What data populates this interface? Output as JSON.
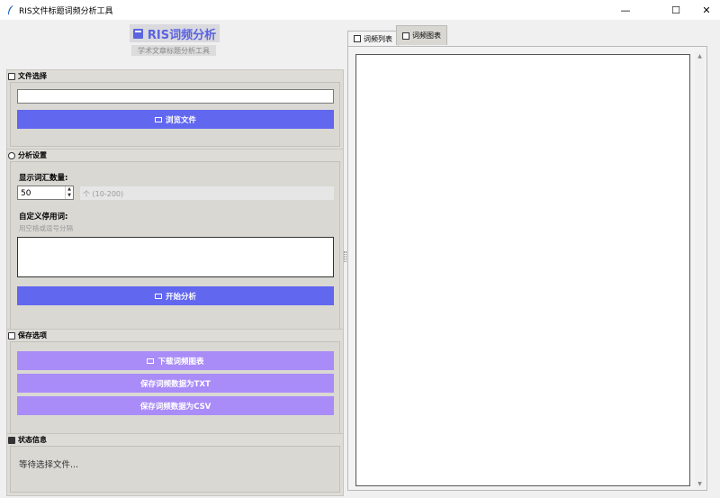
{
  "window": {
    "title": "RIS文件标题词频分析工具",
    "minimize": "—",
    "maximize": "☐",
    "close": "✕"
  },
  "header": {
    "title": "RIS词频分析",
    "subtitle": "学术文章标题分析工具",
    "accent_color": "#5b63e0"
  },
  "file_section": {
    "legend": "文件选择",
    "path_value": "",
    "browse_button": "浏览文件"
  },
  "settings_section": {
    "legend": "分析设置",
    "word_count_label": "显示词汇数量:",
    "word_count_value": "50",
    "word_count_unit": "个 (10-200)",
    "stopwords_label": "自定义停用词:",
    "stopwords_hint": "用空格或逗号分隔",
    "stopwords_value": "",
    "start_button": "开始分析"
  },
  "save_section": {
    "legend": "保存选项",
    "download_chart_button": "下载词频图表",
    "save_txt_button": "保存词频数据为TXT",
    "save_csv_button": "保存词频数据为CSV"
  },
  "status_section": {
    "legend": "状态信息",
    "status_text": "等待选择文件..."
  },
  "tabs": [
    {
      "label": "词频列表",
      "icon": "list-icon",
      "selected": true
    },
    {
      "label": "词频图表",
      "icon": "chart-icon",
      "selected": false
    }
  ],
  "colors": {
    "primary_button": "#6167ef",
    "secondary_button": "#a98cf7",
    "panel_bg": "#dedcd7"
  }
}
